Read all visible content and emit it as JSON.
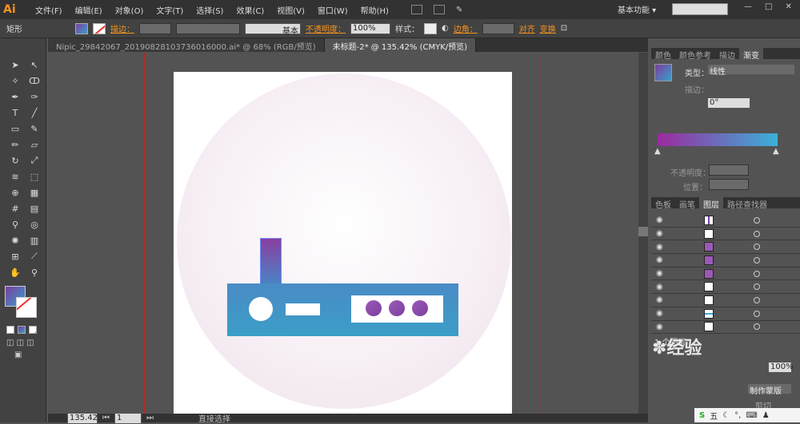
{
  "app": {
    "logo": "Ai",
    "workspace": "基本功能 ▾"
  },
  "menu": [
    "文件(F)",
    "编辑(E)",
    "对象(O)",
    "文字(T)",
    "选择(S)",
    "效果(C)",
    "视图(V)",
    "窗口(W)",
    "帮助(H)"
  ],
  "control": {
    "shape_label": "矩形",
    "stroke_label": "描边：",
    "basic_label": "基本",
    "opacity_label": "不透明度：",
    "opacity_value": "100%",
    "style_label": "样式：",
    "corner_label": "边角：",
    "align_label": "对齐",
    "transform_label": "变换"
  },
  "tabs": [
    {
      "label": "Nipic_29842067_20190828103736016000.ai* @ 68% (RGB/预览)"
    },
    {
      "label": "未标题-2* @ 135.42% (CMYK/预览)"
    }
  ],
  "panel_tabs_top": [
    "颜色",
    "颜色参考",
    "描边",
    "渐变"
  ],
  "gradient": {
    "type_label": "类型：",
    "type_value": "线性",
    "stroke_label": "描边：",
    "angle_value": "0°",
    "opacity_label": "不透明度：",
    "position_label": "位置："
  },
  "panel_tabs_mid": [
    "色板",
    "画笔",
    "图层",
    "路径查找器"
  ],
  "layers_footer": "1 个图层",
  "bottom": {
    "zoom": "135.42",
    "page": "1",
    "tool_label": "直接选择"
  },
  "right_bottom": {
    "percent": "100%",
    "btn_make": "制作蒙版",
    "btn_clip": "剪切"
  },
  "tray": {
    "ime": "五"
  },
  "colors": {
    "grad_start": "#9b2a9e",
    "grad_end": "#3bb0d8",
    "guide": "#c02020"
  }
}
